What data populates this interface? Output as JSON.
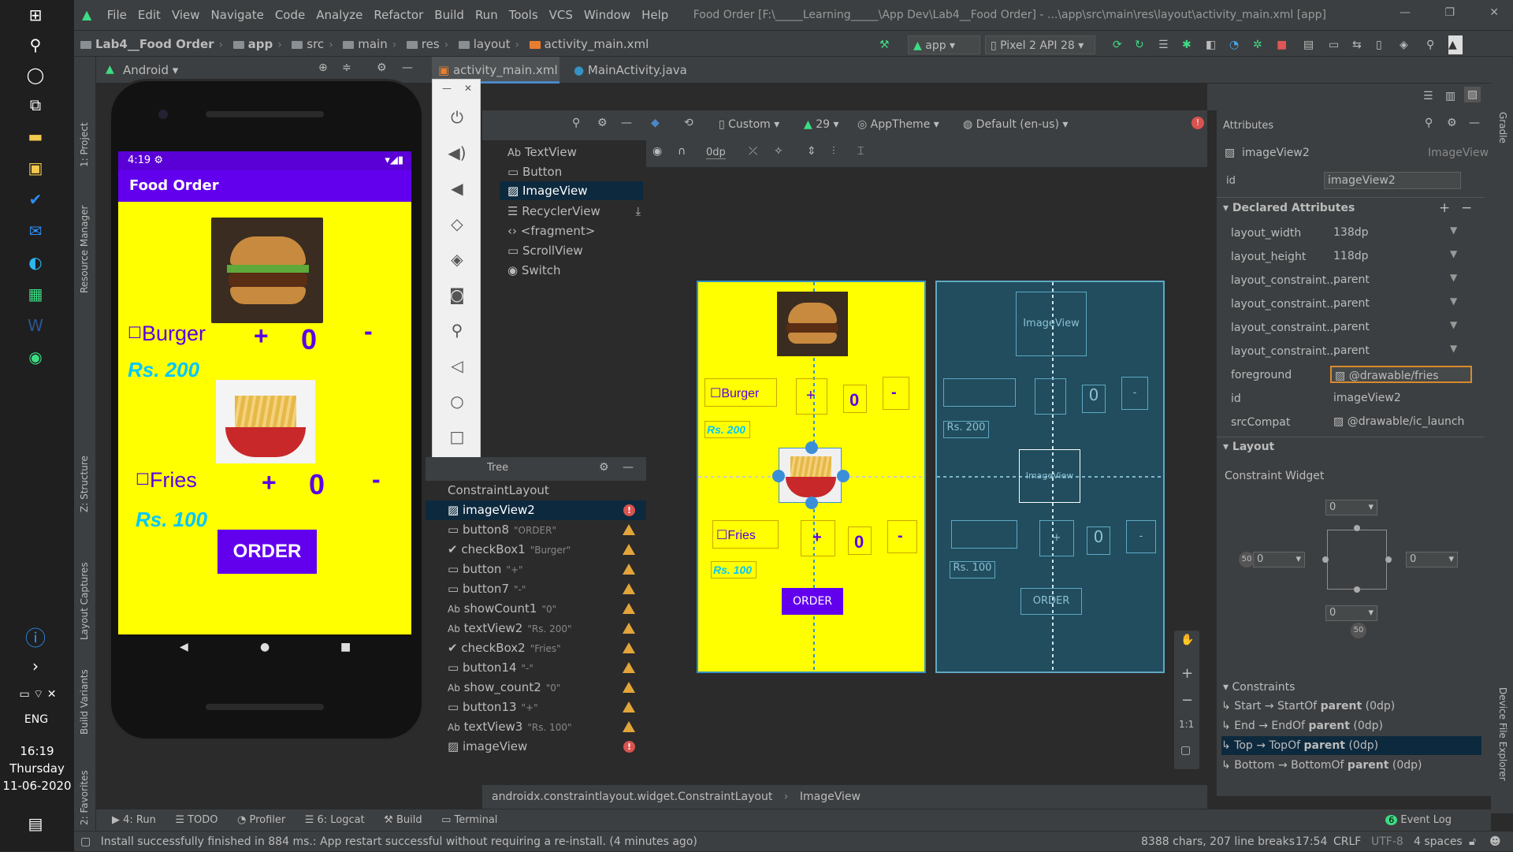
{
  "taskbar": {
    "lang": "ENG",
    "time": "16:19",
    "day": "Thursday",
    "date": "11-06-2020"
  },
  "menu": [
    "File",
    "Edit",
    "View",
    "Navigate",
    "Code",
    "Analyze",
    "Refactor",
    "Build",
    "Run",
    "Tools",
    "VCS",
    "Window",
    "Help"
  ],
  "window_title": "Food Order [F:\\_____Learning_____\\App Dev\\Lab4__Food Order] - ...\\app\\src\\main\\res\\layout\\activity_main.xml [app]",
  "breadcrumb": [
    "Lab4__Food Order",
    "app",
    "src",
    "main",
    "res",
    "layout",
    "activity_main.xml"
  ],
  "run_config": "app",
  "device": "Pixel 2 API 28",
  "project_view": "Android",
  "tabs": [
    "activity_main.xml",
    "MainActivity.java"
  ],
  "phone": {
    "time": "4:19",
    "app_title": "Food Order",
    "burger": "Burger",
    "fries": "Fries",
    "plus": "+",
    "minus": "-",
    "count1": "0",
    "count2": "0",
    "price1": "Rs. 200",
    "price2": "Rs. 100",
    "order": "ORDER"
  },
  "palette": [
    "TextView",
    "Button",
    "ImageView",
    "RecyclerView",
    "<fragment>",
    "ScrollView",
    "Switch"
  ],
  "tree_title": "Tree",
  "tree": {
    "root": "ConstraintLayout",
    "rows": [
      {
        "name": "imageView2",
        "hint": "",
        "status": "error"
      },
      {
        "name": "button8",
        "hint": "\"ORDER\"",
        "status": "warn"
      },
      {
        "name": "checkBox1",
        "hint": "\"Burger\"",
        "status": "warn"
      },
      {
        "name": "button",
        "hint": "\"+\"",
        "status": "warn"
      },
      {
        "name": "button7",
        "hint": "\"-\"",
        "status": "warn"
      },
      {
        "name": "showCount1",
        "hint": "\"0\"",
        "status": "warn"
      },
      {
        "name": "textView2",
        "hint": "\"Rs. 200\"",
        "status": "warn"
      },
      {
        "name": "checkBox2",
        "hint": "\"Fries\"",
        "status": "warn"
      },
      {
        "name": "button14",
        "hint": "\"-\"",
        "status": "warn"
      },
      {
        "name": "show_count2",
        "hint": "\"0\"",
        "status": "warn"
      },
      {
        "name": "button13",
        "hint": "\"+\"",
        "status": "warn"
      },
      {
        "name": "textView3",
        "hint": "\"Rs. 100\"",
        "status": "warn"
      },
      {
        "name": "imageView",
        "hint": "",
        "status": "error"
      }
    ]
  },
  "design_toolbar": {
    "custom": "Custom",
    "api": "29",
    "theme": "AppTheme",
    "locale": "Default (en-us)",
    "margin": "0dp"
  },
  "design": {
    "burger": "Burger",
    "fries": "Fries",
    "plus": "+",
    "minus": "-",
    "zero": "0",
    "price1": "Rs. 200",
    "price2": "Rs. 100",
    "order": "ORDER",
    "imageview": "ImageView",
    "zoom": "1:1"
  },
  "attributes": {
    "title": "Attributes",
    "component": "imageView2",
    "component_type": "ImageView",
    "id_label": "id",
    "id_value": "imageView2",
    "declared_title": "Declared Attributes",
    "rows": [
      {
        "k": "layout_width",
        "v": "138dp"
      },
      {
        "k": "layout_height",
        "v": "118dp"
      },
      {
        "k": "layout_constraint...",
        "v": "parent"
      },
      {
        "k": "layout_constraint...",
        "v": "parent"
      },
      {
        "k": "layout_constraint...",
        "v": "parent"
      },
      {
        "k": "layout_constraint...",
        "v": "parent"
      },
      {
        "k": "foreground",
        "v": "@drawable/fries"
      },
      {
        "k": "id",
        "v": "imageView2"
      },
      {
        "k": "srcCompat",
        "v": "@drawable/ic_launch"
      }
    ],
    "layout_title": "Layout",
    "widget_title": "Constraint Widget",
    "margins": {
      "top": "0",
      "left": "0",
      "right": "0",
      "bottom": "0",
      "bias_v": "50",
      "bias_h": "50"
    },
    "constraints_title": "Constraints",
    "constraints": [
      {
        "a": "Start → StartOf ",
        "b": "parent",
        "c": " (0dp)"
      },
      {
        "a": "End → EndOf ",
        "b": "parent",
        "c": " (0dp)"
      },
      {
        "a": "Top → TopOf ",
        "b": "parent",
        "c": " (0dp)"
      },
      {
        "a": "Bottom → BottomOf ",
        "b": "parent",
        "c": " (0dp)"
      }
    ]
  },
  "crumbs": [
    "androidx.constraintlayout.widget.ConstraintLayout",
    "ImageView"
  ],
  "toolwindows": [
    "4: Run",
    "TODO",
    "Profiler",
    "6: Logcat",
    "Build",
    "Terminal"
  ],
  "event_log": "Event Log",
  "event_count": "6",
  "status": {
    "message": "Install successfully finished in 884 ms.: App restart successful without requiring a re-install. (4 minutes ago)",
    "chars": "8388 chars, 207 line breaks",
    "pos": "17:54",
    "crlf": "CRLF",
    "enc": "UTF-8",
    "indent": "4 spaces"
  },
  "side_labels": {
    "project": "1: Project",
    "resource": "Resource Manager",
    "structure": "Z: Structure",
    "captures": "Layout Captures",
    "variants": "Build Variants",
    "favorites": "2: Favorites",
    "gradle": "Gradle",
    "device": "Device File Explorer"
  }
}
